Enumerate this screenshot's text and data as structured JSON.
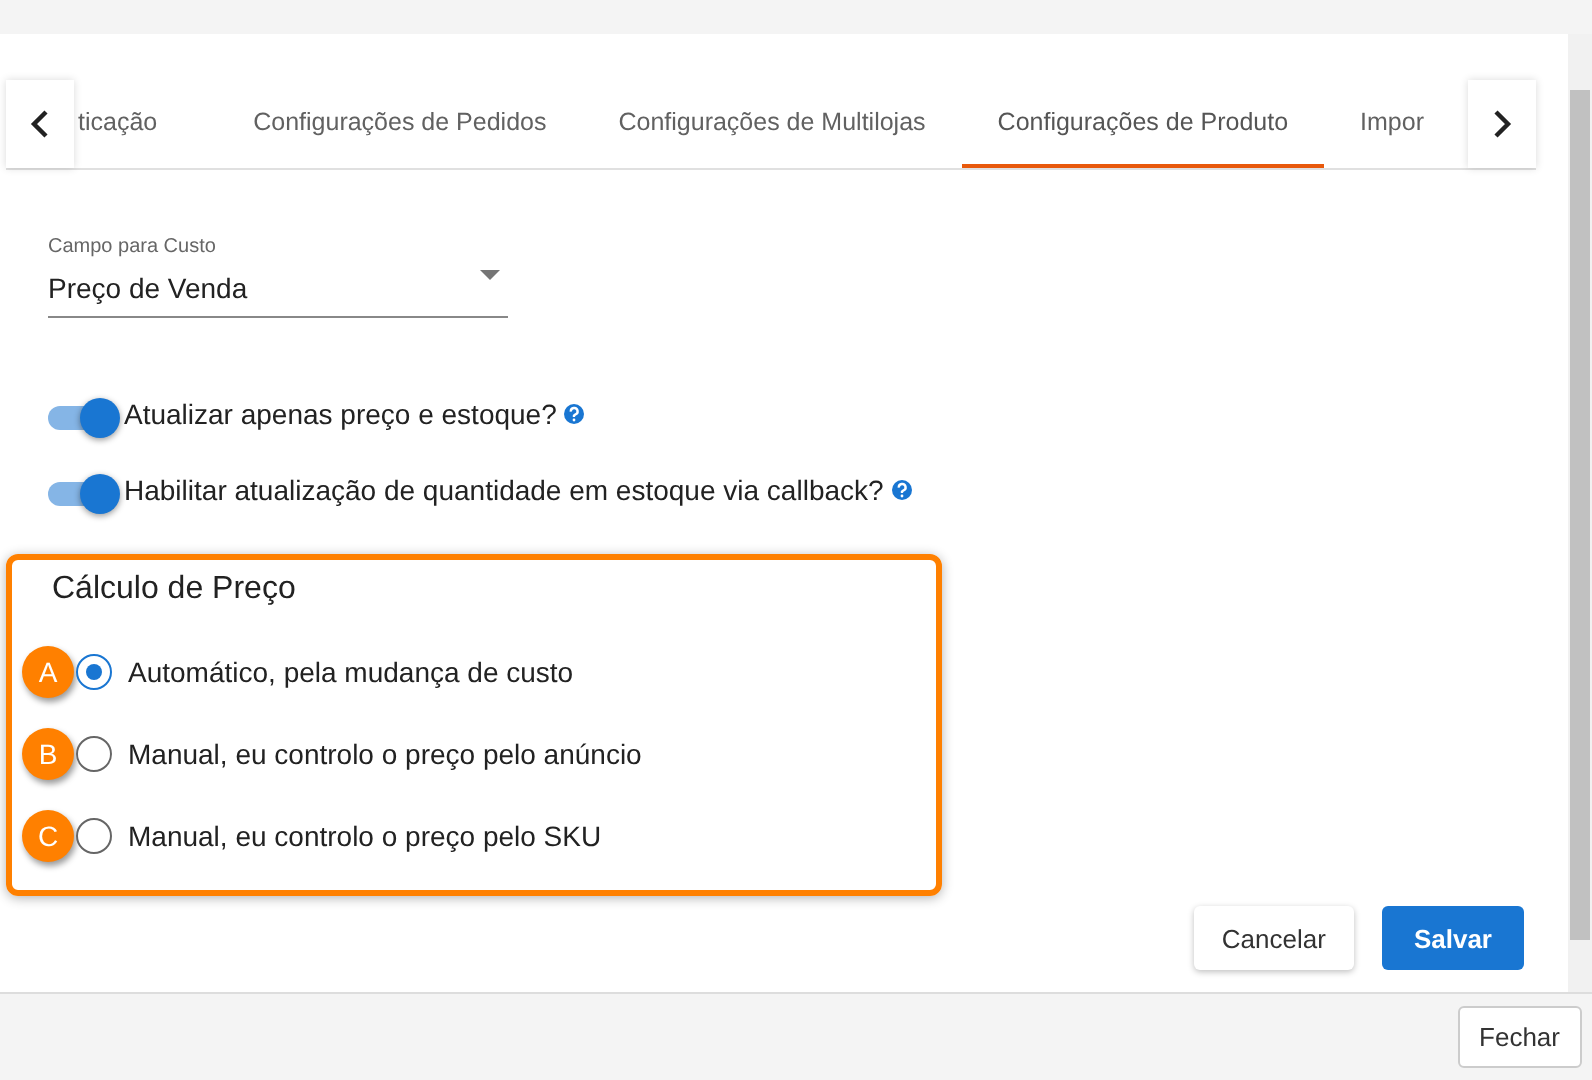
{
  "tabs": [
    {
      "label": "ticação",
      "selected": false
    },
    {
      "label": "Configurações de Pedidos",
      "selected": false
    },
    {
      "label": "Configurações de Multilojas",
      "selected": false
    },
    {
      "label": "Configurações de Produto",
      "selected": true
    },
    {
      "label": "Impor",
      "selected": false
    }
  ],
  "cost_field": {
    "label": "Campo para Custo",
    "value": "Preço de Venda"
  },
  "toggles": [
    {
      "label": "Atualizar apenas preço e estoque?",
      "on": true
    },
    {
      "label": "Habilitar atualização de quantidade em estoque via callback?",
      "on": true
    }
  ],
  "price_calc": {
    "title": "Cálculo de Preço",
    "options": [
      {
        "badge": "A",
        "label": "Automático, pela mudança de custo",
        "selected": true
      },
      {
        "badge": "B",
        "label": "Manual, eu controlo o preço pelo anúncio",
        "selected": false
      },
      {
        "badge": "C",
        "label": "Manual, eu controlo o preço pelo SKU",
        "selected": false
      }
    ]
  },
  "buttons": {
    "cancel": "Cancelar",
    "save": "Salvar"
  },
  "footer": {
    "close": "Fechar"
  }
}
